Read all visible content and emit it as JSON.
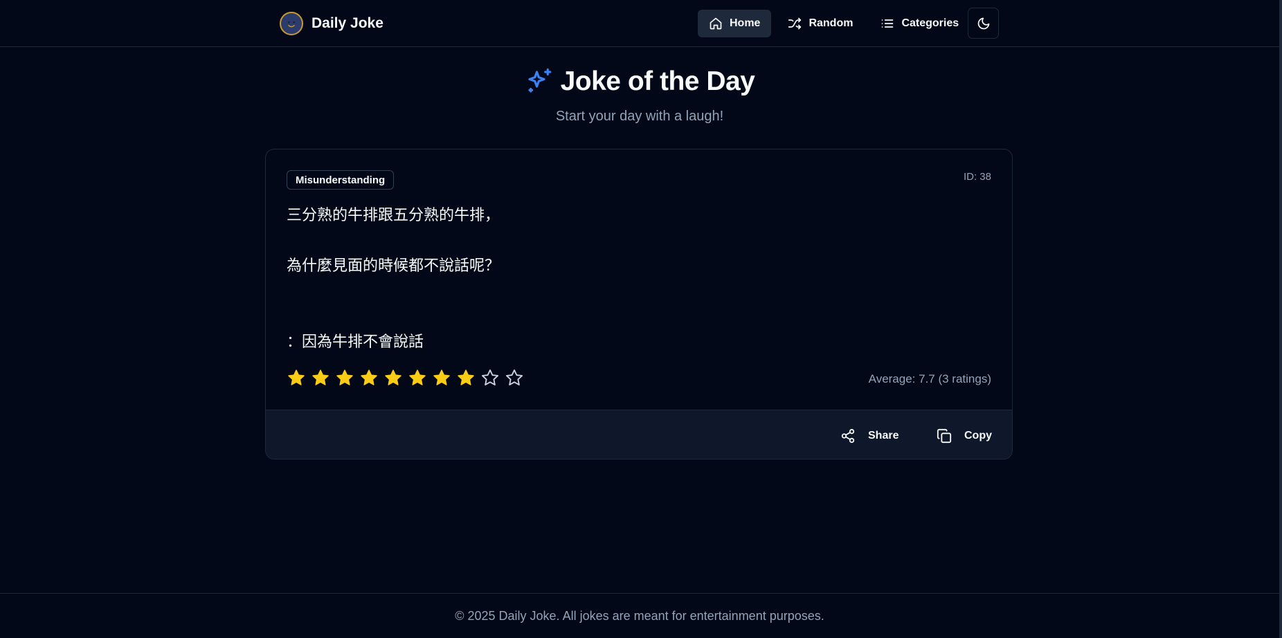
{
  "header": {
    "brand": "Daily Joke",
    "nav": [
      {
        "label": "Home",
        "icon": "home-icon",
        "active": true
      },
      {
        "label": "Random",
        "icon": "shuffle-icon",
        "active": false
      },
      {
        "label": "Categories",
        "icon": "list-icon",
        "active": false
      }
    ],
    "theme_toggle_icon": "moon-icon"
  },
  "hero": {
    "title": "Joke of the Day",
    "subtitle": "Start your day with a laugh!",
    "icon": "sparkles-icon"
  },
  "joke": {
    "category": "Misunderstanding",
    "id_label": "ID: 38",
    "lines": [
      "三分熟的牛排跟五分熟的牛排，",
      "為什麼見面的時候都不說話呢？",
      "：因為牛排不會說話"
    ],
    "rating": {
      "max_stars": 10,
      "filled_stars": 8,
      "average_label": "Average: 7.7 (3 ratings)"
    },
    "actions": {
      "share_label": "Share",
      "copy_label": "Copy"
    }
  },
  "footer": {
    "text": "© 2025 Daily Joke. All jokes are meant for entertainment purposes."
  },
  "colors": {
    "background": "#020817",
    "border": "#1e293b",
    "muted_text": "#94a3b8",
    "star_filled": "#facc15",
    "accent": "#3b82f6"
  }
}
